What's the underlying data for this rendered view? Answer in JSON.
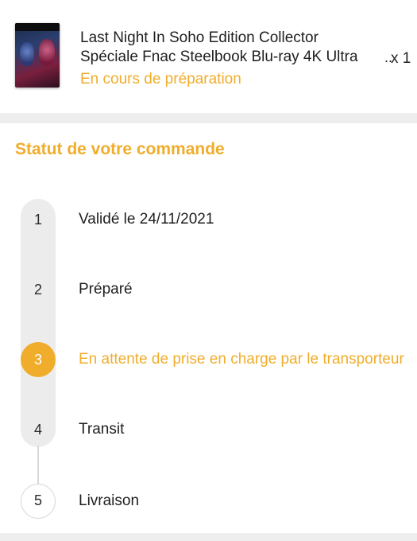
{
  "product": {
    "title_line1": "Last Night In Soho Edition Collector",
    "title_line2": "Spéciale Fnac Steelbook Blu-ray 4K Ultra",
    "ellipsis": "..",
    "quantity": "x 1",
    "status": "En cours de préparation",
    "cover_icon": "movie-cover-image"
  },
  "order_status": {
    "heading": "Statut de votre commande",
    "steps": [
      {
        "number": "1",
        "label": "Validé le 24/11/2021",
        "state": "done"
      },
      {
        "number": "2",
        "label": "Préparé",
        "state": "done"
      },
      {
        "number": "3",
        "label": "En attente de prise en charge par le transporteur",
        "state": "active"
      },
      {
        "number": "4",
        "label": "Transit",
        "state": "upcoming"
      },
      {
        "number": "5",
        "label": "Livraison",
        "state": "pending"
      }
    ]
  },
  "colors": {
    "accent": "#f0ad2b",
    "text": "#1f1f1f",
    "background": "#eeeeee",
    "card": "#ffffff",
    "track": "#ececec"
  }
}
